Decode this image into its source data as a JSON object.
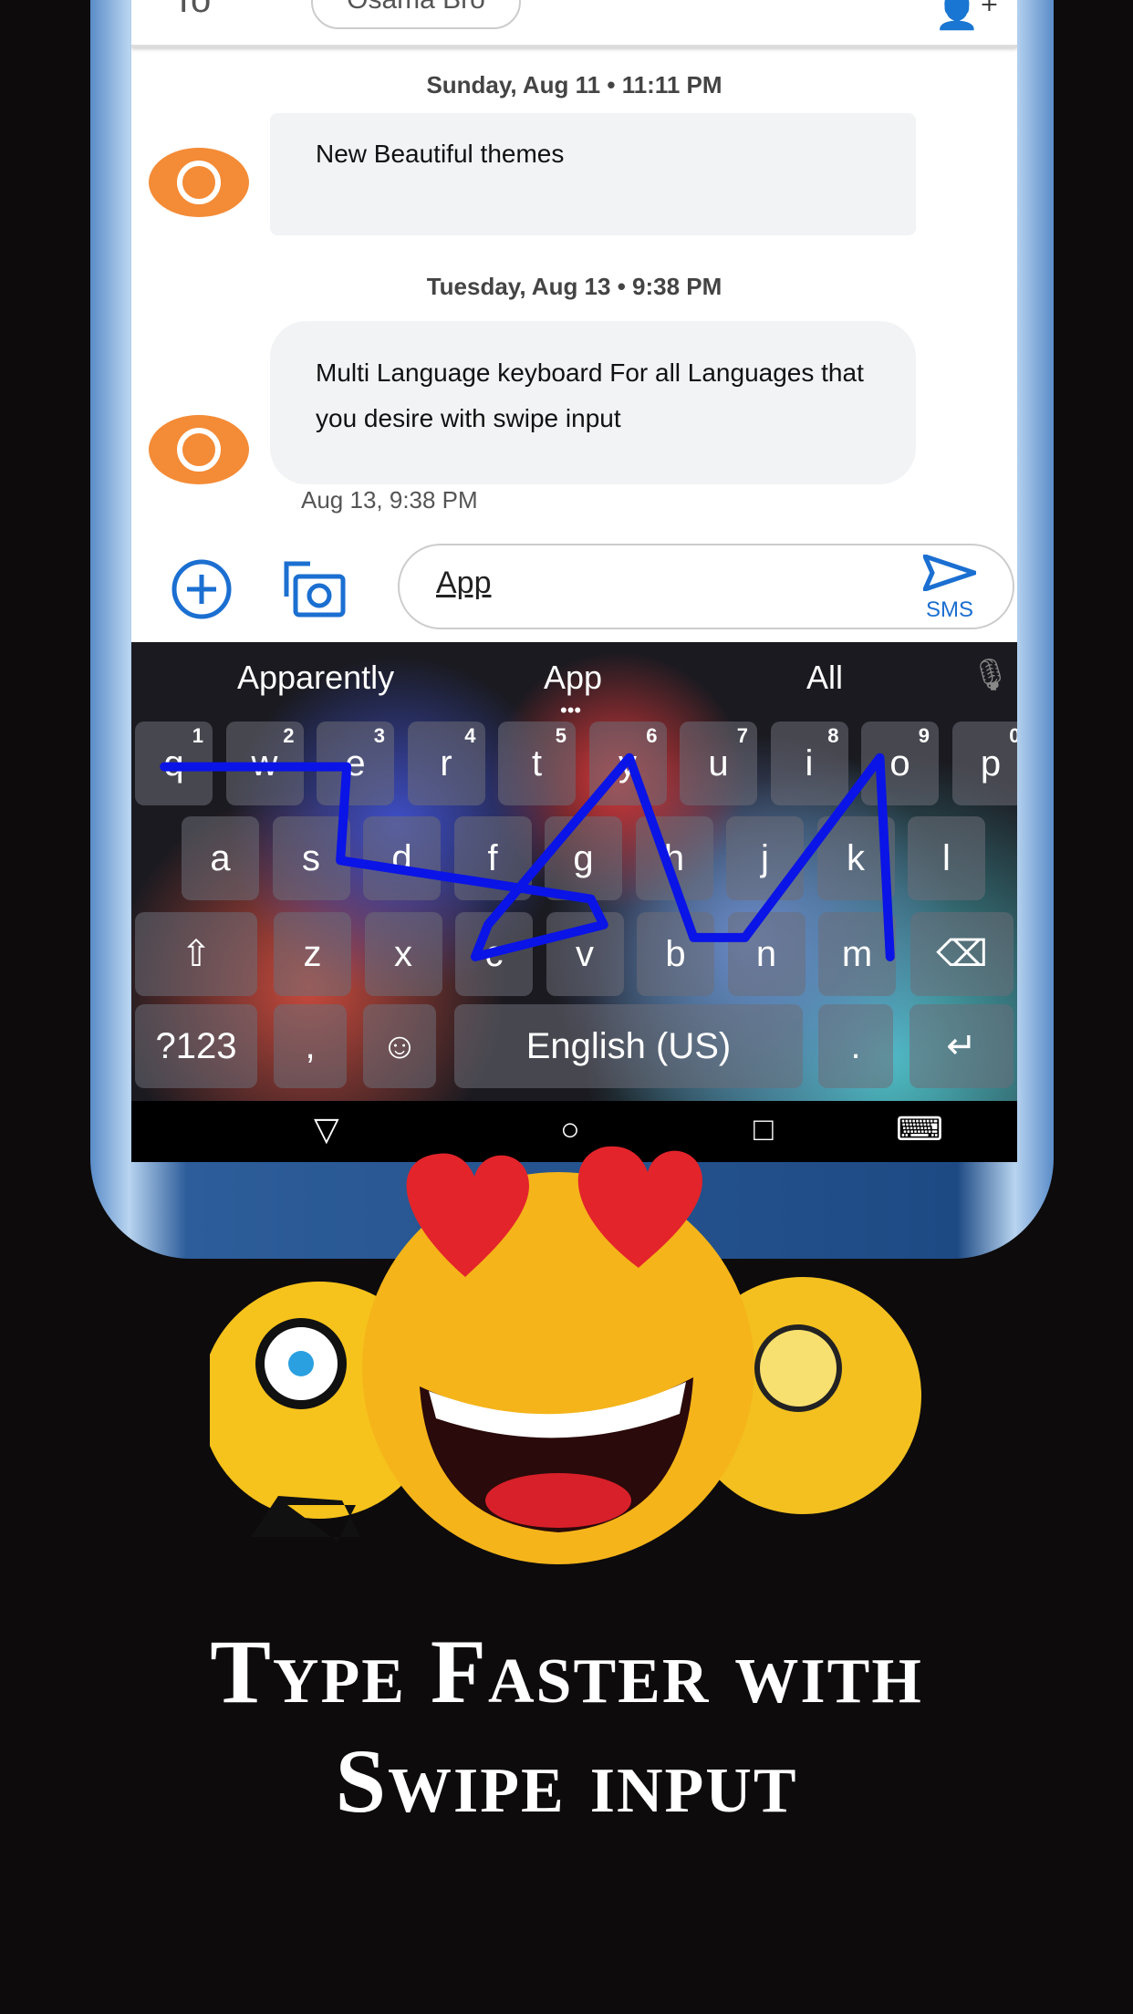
{
  "header": {
    "to_label": "To",
    "recipient_chip": "Osama Bro",
    "add_contact_icon": "add-person-icon"
  },
  "messages": [
    {
      "date": "Sunday, Aug 11 • 11:11 PM",
      "text": "New Beautiful themes"
    },
    {
      "date": "Tuesday, Aug 13 • 9:38 PM",
      "text": "Multi Language keyboard For all Languages that you desire with swipe input",
      "timestamp": "Aug 13, 9:38 PM"
    }
  ],
  "compose": {
    "value": "App",
    "send_label": "SMS"
  },
  "keyboard": {
    "suggestions": [
      "Apparently",
      "App",
      "All"
    ],
    "row1": [
      [
        "q",
        "1"
      ],
      [
        "w",
        "2"
      ],
      [
        "e",
        "3"
      ],
      [
        "r",
        "4"
      ],
      [
        "t",
        "5"
      ],
      [
        "y",
        "6"
      ],
      [
        "u",
        "7"
      ],
      [
        "i",
        "8"
      ],
      [
        "o",
        "9"
      ],
      [
        "p",
        "0"
      ]
    ],
    "row2": [
      "a",
      "s",
      "d",
      "f",
      "g",
      "h",
      "j",
      "k",
      "l"
    ],
    "row3": [
      "z",
      "x",
      "c",
      "v",
      "b",
      "n",
      "m"
    ],
    "symbols_label": "?123",
    "comma": ",",
    "space_label": "English (US)",
    "period": ".",
    "swipe_color": "#0a14e6"
  },
  "tagline": [
    "Type Faster with",
    "Swipe input"
  ]
}
